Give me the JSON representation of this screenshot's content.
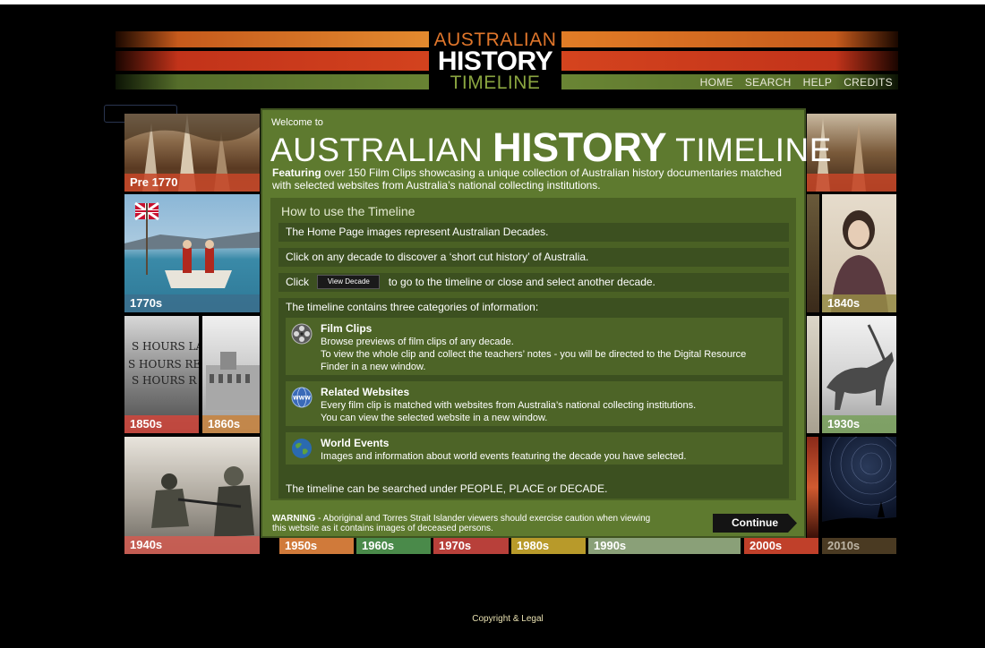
{
  "header": {
    "logo_line1": "AUSTRALIAN",
    "logo_line2": "HISTORY",
    "logo_line3": "TIMELINE",
    "nav": [
      "HOME",
      "SEARCH",
      "HELP",
      "CREDITS"
    ]
  },
  "tiles": {
    "pre1770": "Pre 1770",
    "t1770s": "1770s",
    "t1840s": "1840s",
    "t1850s": "1850s",
    "t1860s": "1860s",
    "t1930s": "1930s",
    "t1940s": "1940s",
    "decades_bottom": [
      "1950s",
      "1960s",
      "1970s",
      "1980s",
      "1990s",
      "2000s",
      "2010s"
    ]
  },
  "overlay": {
    "welcome": "Welcome to",
    "title_part1": "AUSTRALIAN ",
    "title_part2": "HISTORY",
    "title_part3": " TIMELINE",
    "featuring_bold": "Featuring",
    "featuring_text": " over 150 Film Clips showcasing a unique collection of Australian history documentaries matched with selected websites from Australia’s national collecting institutions.",
    "howto_heading": "How to use the Timeline",
    "row1": "The Home Page images represent Australian Decades.",
    "row2": "Click on any decade to discover a ‘short cut history’ of Australia.",
    "row3_before": "Click",
    "row3_button": "View Decade",
    "row3_after": "to go to the timeline or close and select another decade.",
    "categories_heading": "The timeline contains three categories of information:",
    "categories": [
      {
        "title": "Film Clips",
        "desc": "Browse previews of film clips of any decade.\nTo view the whole clip and collect the teachers’ notes - you will be directed to the Digital Resource Finder in a new window.",
        "icon": "film-reel-icon"
      },
      {
        "title": "Related Websites",
        "desc": "Every film clip is matched with websites from Australia’s national collecting institutions.\nYou can view the selected website in a new window.",
        "icon": "www-globe-icon"
      },
      {
        "title": "World Events",
        "desc": "Images and information about world events featuring the decade you have selected.",
        "icon": "earth-icon"
      }
    ],
    "search_row": "The timeline can be searched under PEOPLE, PLACE or DECADE.",
    "warning_bold": "WARNING",
    "warning_text": " - Aboriginal and Torres Strait Islander viewers should exercise caution when viewing this website as it contains images of deceased persons.",
    "continue_label": "Continue"
  },
  "footer": {
    "copyright": "Copyright & Legal"
  },
  "colors": {
    "panel_green": "#5e7a2f",
    "inner_green": "#4a6124",
    "row_green": "#3c5020",
    "logo_orange": "#e0762b",
    "logo_green": "#8aa540",
    "stripe_red": "#d8471f"
  }
}
